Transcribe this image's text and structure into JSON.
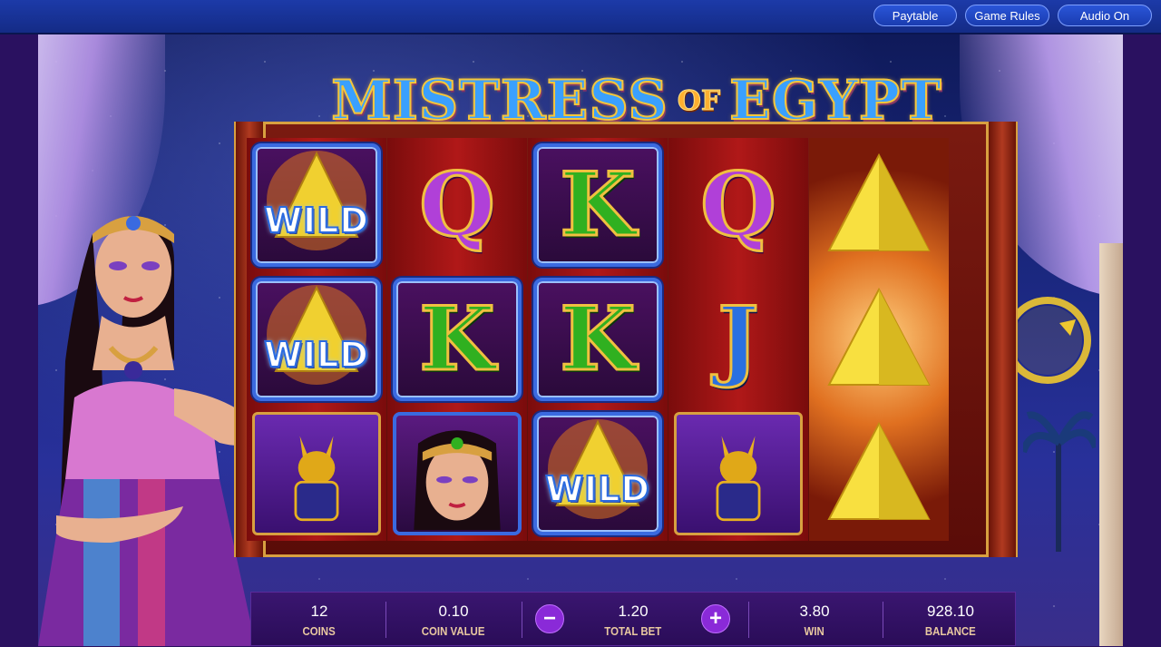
{
  "top_bar": {
    "paytable_label": "Paytable",
    "game_rules_label": "Game Rules",
    "audio_label": "Audio On"
  },
  "title": {
    "word1": "MISTRESS",
    "word2": "OF",
    "word3": "EGYPT"
  },
  "reels": [
    [
      {
        "symbol": "wild",
        "text": "WILD"
      },
      {
        "symbol": "wild",
        "text": "WILD"
      },
      {
        "symbol": "cat"
      }
    ],
    [
      {
        "symbol": "Q",
        "text": "Q"
      },
      {
        "symbol": "K",
        "text": "K"
      },
      {
        "symbol": "cleopatra"
      }
    ],
    [
      {
        "symbol": "K",
        "text": "K"
      },
      {
        "symbol": "K",
        "text": "K"
      },
      {
        "symbol": "wild",
        "text": "WILD"
      }
    ],
    [
      {
        "symbol": "Q",
        "text": "Q"
      },
      {
        "symbol": "J",
        "text": "J"
      },
      {
        "symbol": "cat"
      }
    ],
    [
      {
        "symbol": "pyramid"
      },
      {
        "symbol": "pyramid"
      },
      {
        "symbol": "pyramid"
      }
    ]
  ],
  "bottom_bar": {
    "coins_value": "12",
    "coins_label": "COINS",
    "coin_value_value": "0.10",
    "coin_value_label": "COIN VALUE",
    "decrease_label": "−",
    "total_bet_value": "1.20",
    "total_bet_label": "TOTAL BET",
    "increase_label": "+",
    "win_value": "3.80",
    "win_label": "WIN",
    "balance_value": "928.10",
    "balance_label": "BALANCE"
  },
  "colors": {
    "top_bar": "#1c3aa8",
    "accent_purple": "#8a2ad8",
    "gold": "#d8a040",
    "spin_gold": "#e8b820"
  },
  "icons": {
    "spin": "circular-arrow-icon"
  }
}
